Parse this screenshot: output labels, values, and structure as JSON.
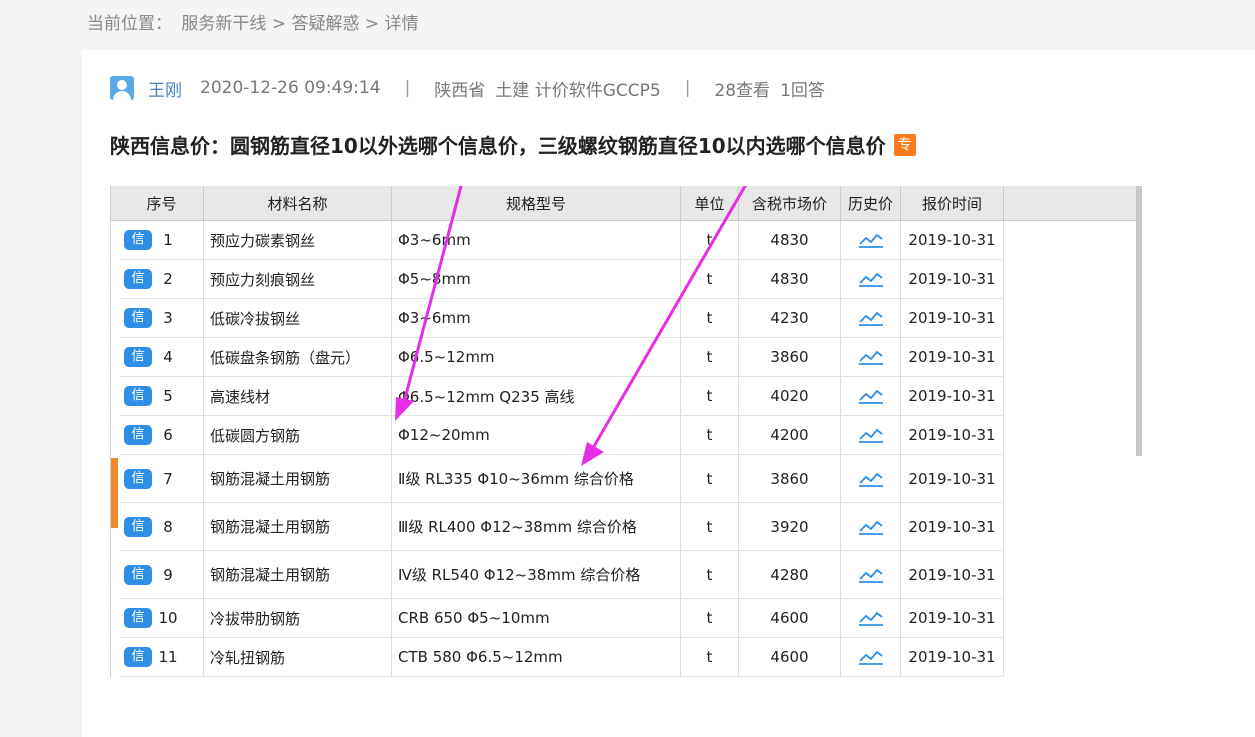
{
  "breadcrumb": {
    "label": "当前位置：",
    "path": "服务新干线 > 答疑解惑 > 详情"
  },
  "post": {
    "author": "王刚",
    "datetime": "2020-12-26 09:49:14",
    "separator": "|",
    "region": "陕西省",
    "category": "土建 计价软件GCCP5",
    "views": "28查看",
    "answers": "1回答",
    "title": "陕西信息价：圆钢筋直径10以外选哪个信息价，三级螺纹钢筋直径10以内选哪个信息价",
    "badge": "专"
  },
  "table": {
    "headers": [
      "序号",
      "材料名称",
      "规格型号",
      "单位",
      "含税市场价",
      "历史价",
      "报价时间"
    ],
    "tag": "信",
    "rows": [
      {
        "no": "1",
        "name": "预应力碳素钢丝",
        "spec": "Φ3~6mm",
        "unit": "t",
        "price": "4830",
        "date": "2019-10-31"
      },
      {
        "no": "2",
        "name": "预应力刻痕钢丝",
        "spec": "Φ5~8mm",
        "unit": "t",
        "price": "4830",
        "date": "2019-10-31"
      },
      {
        "no": "3",
        "name": "低碳冷拔钢丝",
        "spec": "Φ3~6mm",
        "unit": "t",
        "price": "4230",
        "date": "2019-10-31"
      },
      {
        "no": "4",
        "name": "低碳盘条钢筋（盘元）",
        "spec": "Φ6.5~12mm",
        "unit": "t",
        "price": "3860",
        "date": "2019-10-31"
      },
      {
        "no": "5",
        "name": "高速线材",
        "spec": "Φ6.5~12mm Q235  高线",
        "unit": "t",
        "price": "4020",
        "date": "2019-10-31"
      },
      {
        "no": "6",
        "name": "低碳圆方钢筋",
        "spec": "Φ12~20mm",
        "unit": "t",
        "price": "4200",
        "date": "2019-10-31"
      },
      {
        "no": "7",
        "name": "钢筋混凝土用钢筋",
        "spec": "Ⅱ级 RL335  Φ10~36mm  综合价格",
        "unit": "t",
        "price": "3860",
        "date": "2019-10-31"
      },
      {
        "no": "8",
        "name": "钢筋混凝土用钢筋",
        "spec": "Ⅲ级 RL400  Φ12~38mm  综合价格",
        "unit": "t",
        "price": "3920",
        "date": "2019-10-31"
      },
      {
        "no": "9",
        "name": "钢筋混凝土用钢筋",
        "spec": "Ⅳ级 RL540  Φ12~38mm  综合价格",
        "unit": "t",
        "price": "4280",
        "date": "2019-10-31"
      },
      {
        "no": "10",
        "name": "冷拔带肋钢筋",
        "spec": "CRB 650 Φ5~10mm",
        "unit": "t",
        "price": "4600",
        "date": "2019-10-31"
      },
      {
        "no": "11",
        "name": "冷轧扭钢筋",
        "spec": "CTB 580 Φ6.5~12mm",
        "unit": "t",
        "price": "4600",
        "date": "2019-10-31"
      }
    ]
  },
  "colors": {
    "accent": "#2f8fe6",
    "arrow": "#e62ee6",
    "badge": "#ff7a1a"
  },
  "icons": {
    "avatar": "user-avatar-icon",
    "history": "line-chart-icon"
  }
}
